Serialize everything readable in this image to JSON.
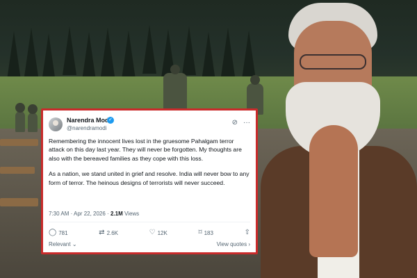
{
  "tweet": {
    "author_name": "Narendra Modi",
    "handle": "@narendramodi",
    "paragraphs": [
      "Remembering the innocent lives lost in the gruesome Pahalgam terror attack on this day last year. They will never be forgotten. My thoughts are also with the bereaved families as they cope with this loss.",
      "As a nation, we stand united in grief and resolve. India will never bow to any form of terror. The heinous designs of terrorists will never succeed."
    ],
    "timestamp": "7:30 AM · Apr 22, 2026 ·",
    "views_count": "2.1M",
    "views_label": "Views",
    "replies": "781",
    "reposts": "2.6K",
    "likes": "12K",
    "bookmarks": "183",
    "sort_label": "Relevant",
    "view_quotes": "View quotes"
  },
  "icons": {
    "verified": "verified-badge-icon",
    "grok": "grok-icon",
    "more": "more-icon",
    "reply": "reply-icon",
    "repost": "repost-icon",
    "like": "like-icon",
    "bookmark": "bookmark-icon",
    "share": "share-icon"
  },
  "colors": {
    "card_border": "#c92b2b",
    "verified_blue": "#1d9bf0",
    "muted_text": "#536471"
  }
}
